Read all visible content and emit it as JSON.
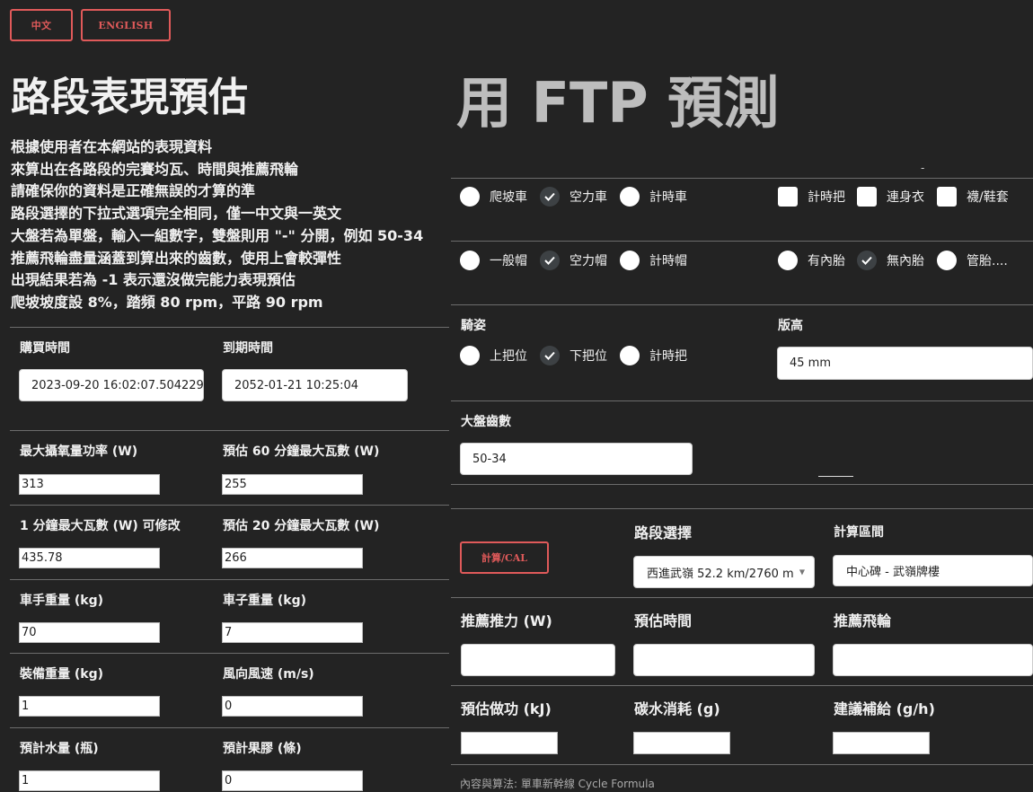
{
  "lang": {
    "zh": "中文",
    "en": "ENGLISH"
  },
  "left": {
    "title": "路段表現預估",
    "description": [
      "根據使用者在本網站的表現資料",
      "來算出在各路段的完賽均瓦、時間與推薦飛輪",
      "請確保你的資料是正確無誤的才算的準",
      "路段選擇的下拉式選項完全相同，僅一中文與一英文",
      "大盤若為單盤，輸入一組數字，雙盤則用 \"-\" 分開，例如 50-34",
      "推薦飛輪盡量涵蓋到算出來的齒數，使用上會較彈性",
      "出現結果若為 -1 表示還沒做完能力表現預估",
      "爬坡坡度設 8%，踏頻 80 rpm，平路 90 rpm"
    ],
    "purchase_label": "購買時間",
    "purchase_value": "2023-09-20 16:02:07.504229",
    "expiry_label": "到期時間",
    "expiry_value": "2052-01-21 10:25:04",
    "fields": [
      {
        "label": "最大攝氧量功率 (W)",
        "value": "313"
      },
      {
        "label": "預估 60 分鐘最大瓦數 (W)",
        "value": "255"
      },
      {
        "label": "1 分鐘最大瓦數 (W) 可修改",
        "value": "435.78"
      },
      {
        "label": "預估 20 分鐘最大瓦數 (W)",
        "value": "266"
      },
      {
        "label": "車手重量 (kg)",
        "value": "70"
      },
      {
        "label": "車子重量 (kg)",
        "value": "7"
      },
      {
        "label": "裝備重量 (kg)",
        "value": "1"
      },
      {
        "label": "風向風速 (m/s)",
        "value": "0"
      },
      {
        "label": "預計水量 (瓶)",
        "value": "1"
      },
      {
        "label": "預計果膠 (條)",
        "value": "0"
      }
    ]
  },
  "right": {
    "title": "用 FTP 預測",
    "dash": "-",
    "bike_types": [
      "爬坡車",
      "空力車",
      "計時車"
    ],
    "bike_selected": 1,
    "equipment": [
      "計時把",
      "連身衣",
      "襪/鞋套"
    ],
    "helmets": [
      "一般帽",
      "空力帽",
      "計時帽"
    ],
    "helmet_selected": 1,
    "tires": [
      "有內胎",
      "無內胎",
      "管胎...."
    ],
    "tire_selected": 1,
    "posture_label": "騎姿",
    "postures": [
      "上把位",
      "下把位",
      "計時把"
    ],
    "posture_selected": 1,
    "frame_label": "版高",
    "frame_value": "45 mm",
    "chainring_label": "大盤齒數",
    "chainring_value": "50-34",
    "calc_button": "計算/CAL",
    "route_label": "路段選擇",
    "route_value": "西進武嶺 52.2 km/2760 m",
    "interval_label": "計算區間",
    "interval_value": "中心碑 - 武嶺牌樓",
    "power_label": "推薦推力 (W)",
    "time_label": "預估時間",
    "cassette_label": "推薦飛輪",
    "work_label": "預估做功 (kJ)",
    "carb_label": "碳水消耗 (g)",
    "supply_label": "建議補給 (g/h)",
    "footer": "內容與算法: 單車新幹線 Cycle Formula"
  }
}
